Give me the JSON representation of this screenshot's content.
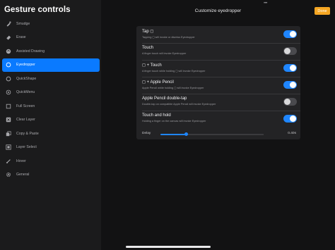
{
  "sidebar": {
    "title": "Gesture controls",
    "items": [
      {
        "label": "Smudge",
        "icon": "smudge-icon"
      },
      {
        "label": "Erase",
        "icon": "eraser-icon"
      },
      {
        "label": "Assisted Drawing",
        "icon": "assisted-drawing-icon"
      },
      {
        "label": "Eyedropper",
        "icon": "eyedropper-icon",
        "active": true
      },
      {
        "label": "QuickShape",
        "icon": "quickshape-icon"
      },
      {
        "label": "QuickMenu",
        "icon": "quickmenu-icon"
      },
      {
        "label": "Full Screen",
        "icon": "fullscreen-icon"
      },
      {
        "label": "Clear Layer",
        "icon": "clear-layer-icon"
      },
      {
        "label": "Copy & Paste",
        "icon": "copy-paste-icon"
      },
      {
        "label": "Layer Select",
        "icon": "layer-select-icon"
      },
      {
        "label": "Hover",
        "icon": "hover-icon"
      },
      {
        "label": "General",
        "icon": "gear-icon"
      }
    ]
  },
  "header": {
    "dots": "•••",
    "title": "Customize eyedropper",
    "done_label": "Done"
  },
  "settings": [
    {
      "title": "Tap ◻",
      "desc": "Tapping ◻ will invoke or dismiss Eyedropper",
      "on": true
    },
    {
      "title": "Touch",
      "desc": "A finger touch will invoke Eyedropper",
      "on": false
    },
    {
      "title": "◻ + Touch",
      "desc": "A finger touch while holding ◻ will invoke Eyedropper",
      "on": true
    },
    {
      "title": "◻ + Apple Pencil",
      "desc": "Apple Pencil while holding ◻ will invoke Eyedropper",
      "on": true
    },
    {
      "title": "Apple Pencil double-tap",
      "desc": "Double-tap on compatible Apple Pencil will invoke Eyedropper",
      "on": false
    },
    {
      "title": "Touch and hold",
      "desc": "Holding a finger on the canvas will invoke Eyedropper",
      "on": true
    }
  ],
  "delay": {
    "label": "Delay",
    "value": "0.40s",
    "fraction": 0.2
  },
  "colors": {
    "accent": "#0a7aff",
    "done": "#f5a623"
  }
}
